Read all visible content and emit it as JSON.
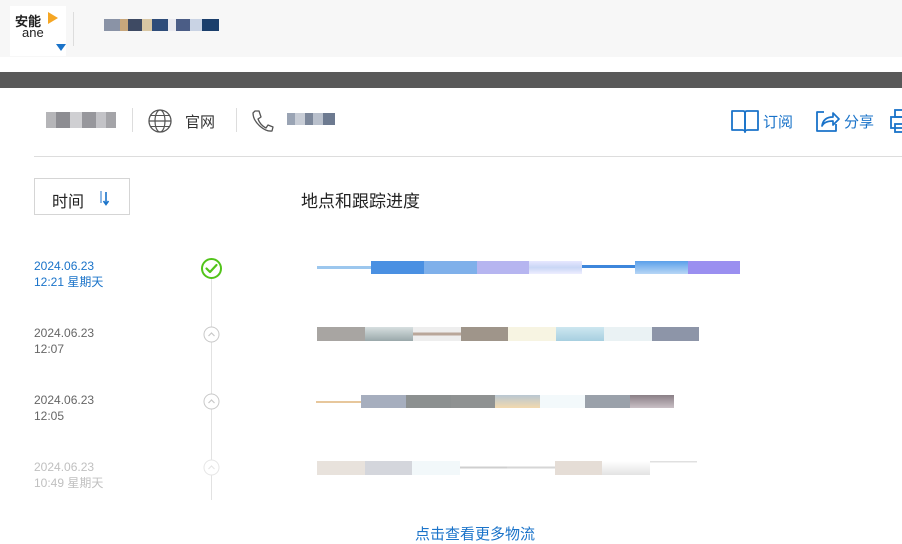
{
  "header": {
    "logo_cn": "安能",
    "logo_en": "ane"
  },
  "info_bar": {
    "website_label": "官网"
  },
  "actions": {
    "subscribe_label": "订阅",
    "share_label": "分享"
  },
  "sort": {
    "label": "时间"
  },
  "column_title": "地点和跟踪进度",
  "events": [
    {
      "date": "2024.06.23",
      "time": "12:21 星期天",
      "status": "latest"
    },
    {
      "date": "2024.06.23",
      "time": "12:07",
      "status": "past"
    },
    {
      "date": "2024.06.23",
      "time": "12:05",
      "status": "past"
    },
    {
      "date": "2024.06.23",
      "time": "10:49 星期天",
      "status": "faded"
    }
  ],
  "more_link": "点击查看更多物流",
  "colors": {
    "accent": "#1a73c9",
    "done": "#52c41a",
    "past_text": "#666666",
    "faded_text": "#c0c0c0"
  }
}
